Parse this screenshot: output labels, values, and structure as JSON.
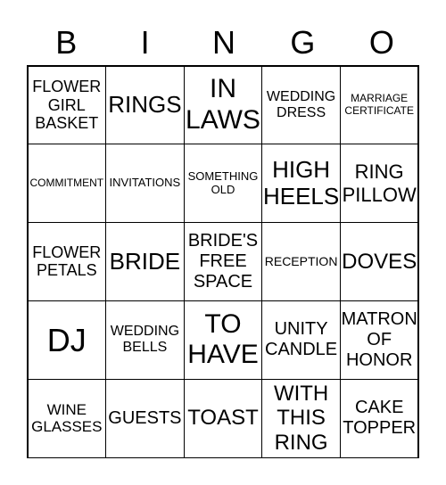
{
  "header": [
    "B",
    "I",
    "N",
    "G",
    "O"
  ],
  "cells": [
    "FLOWER\nGIRL\nBASKET",
    "RINGS",
    "IN\nLAWS",
    "WEDDING\nDRESS",
    "MARRIAGE\nCERTIFICATE",
    "COMMITMENT",
    "INVITATIONS",
    "SOMETHING\nOLD",
    "HIGH\nHEELS",
    "RING\nPILLOW",
    "FLOWER\nPETALS",
    "BRIDE",
    "BRIDE'S\nFREE\nSPACE",
    "RECEPTION",
    "DOVES",
    "DJ",
    "WEDDING\nBELLS",
    "TO\nHAVE",
    "UNITY\nCANDLE",
    "MATRON\nOF\nHONOR",
    "WINE\nGLASSES",
    "GUESTS",
    "TOAST",
    "WITH\nTHIS\nRING",
    "CAKE\nTOPPER"
  ]
}
